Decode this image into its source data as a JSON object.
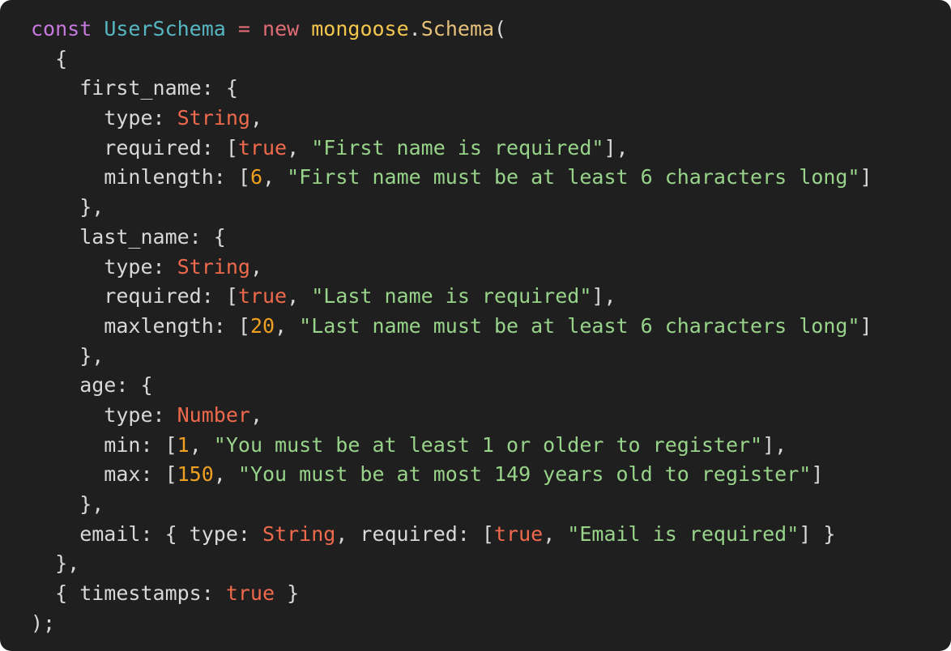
{
  "theme": {
    "background": "#1f1f1f",
    "text": "#d8d8d8",
    "keyword": "#c678dd",
    "identifier": "#56b6c2",
    "operator": "#e06c75",
    "builtin": "#f3c74e",
    "class": "#e5c07b",
    "type": "#ef6a4c",
    "number": "#f0a020",
    "string": "#98d38a"
  },
  "code": {
    "language": "javascript",
    "lines": [
      [
        {
          "k": "keyword",
          "t": "const"
        },
        {
          "k": "plain",
          "t": " "
        },
        {
          "k": "ident",
          "t": "UserSchema"
        },
        {
          "k": "plain",
          "t": " "
        },
        {
          "k": "operator",
          "t": "="
        },
        {
          "k": "plain",
          "t": " "
        },
        {
          "k": "operator",
          "t": "new"
        },
        {
          "k": "plain",
          "t": " "
        },
        {
          "k": "mongoose",
          "t": "mongoose"
        },
        {
          "k": "plain",
          "t": "."
        },
        {
          "k": "class",
          "t": "Schema"
        },
        {
          "k": "plain",
          "t": "("
        }
      ],
      [
        {
          "k": "plain",
          "t": "  {"
        }
      ],
      [
        {
          "k": "plain",
          "t": "    first_name: {"
        }
      ],
      [
        {
          "k": "plain",
          "t": "      type: "
        },
        {
          "k": "type",
          "t": "String"
        },
        {
          "k": "plain",
          "t": ","
        }
      ],
      [
        {
          "k": "plain",
          "t": "      required: ["
        },
        {
          "k": "bool",
          "t": "true"
        },
        {
          "k": "plain",
          "t": ", "
        },
        {
          "k": "string",
          "t": "\"First name is required\""
        },
        {
          "k": "plain",
          "t": "],"
        }
      ],
      [
        {
          "k": "plain",
          "t": "      minlength: ["
        },
        {
          "k": "number",
          "t": "6"
        },
        {
          "k": "plain",
          "t": ", "
        },
        {
          "k": "string",
          "t": "\"First name must be at least 6 characters long\""
        },
        {
          "k": "plain",
          "t": "]"
        }
      ],
      [
        {
          "k": "plain",
          "t": "    },"
        }
      ],
      [
        {
          "k": "plain",
          "t": "    last_name: {"
        }
      ],
      [
        {
          "k": "plain",
          "t": "      type: "
        },
        {
          "k": "type",
          "t": "String"
        },
        {
          "k": "plain",
          "t": ","
        }
      ],
      [
        {
          "k": "plain",
          "t": "      required: ["
        },
        {
          "k": "bool",
          "t": "true"
        },
        {
          "k": "plain",
          "t": ", "
        },
        {
          "k": "string",
          "t": "\"Last name is required\""
        },
        {
          "k": "plain",
          "t": "],"
        }
      ],
      [
        {
          "k": "plain",
          "t": "      maxlength: ["
        },
        {
          "k": "number",
          "t": "20"
        },
        {
          "k": "plain",
          "t": ", "
        },
        {
          "k": "string",
          "t": "\"Last name must be at least 6 characters long\""
        },
        {
          "k": "plain",
          "t": "]"
        }
      ],
      [
        {
          "k": "plain",
          "t": "    },"
        }
      ],
      [
        {
          "k": "plain",
          "t": "    age: {"
        }
      ],
      [
        {
          "k": "plain",
          "t": "      type: "
        },
        {
          "k": "type",
          "t": "Number"
        },
        {
          "k": "plain",
          "t": ","
        }
      ],
      [
        {
          "k": "plain",
          "t": "      min: ["
        },
        {
          "k": "number",
          "t": "1"
        },
        {
          "k": "plain",
          "t": ", "
        },
        {
          "k": "string",
          "t": "\"You must be at least 1 or older to register\""
        },
        {
          "k": "plain",
          "t": "],"
        }
      ],
      [
        {
          "k": "plain",
          "t": "      max: ["
        },
        {
          "k": "number",
          "t": "150"
        },
        {
          "k": "plain",
          "t": ", "
        },
        {
          "k": "string",
          "t": "\"You must be at most 149 years old to register\""
        },
        {
          "k": "plain",
          "t": "]"
        }
      ],
      [
        {
          "k": "plain",
          "t": "    },"
        }
      ],
      [
        {
          "k": "plain",
          "t": "    email: { type: "
        },
        {
          "k": "type",
          "t": "String"
        },
        {
          "k": "plain",
          "t": ", required: ["
        },
        {
          "k": "bool",
          "t": "true"
        },
        {
          "k": "plain",
          "t": ", "
        },
        {
          "k": "string",
          "t": "\"Email is required\""
        },
        {
          "k": "plain",
          "t": "] }"
        }
      ],
      [
        {
          "k": "plain",
          "t": "  },"
        }
      ],
      [
        {
          "k": "plain",
          "t": "  { timestamps: "
        },
        {
          "k": "bool",
          "t": "true"
        },
        {
          "k": "plain",
          "t": " }"
        }
      ],
      [
        {
          "k": "plain",
          "t": ");"
        }
      ]
    ]
  }
}
